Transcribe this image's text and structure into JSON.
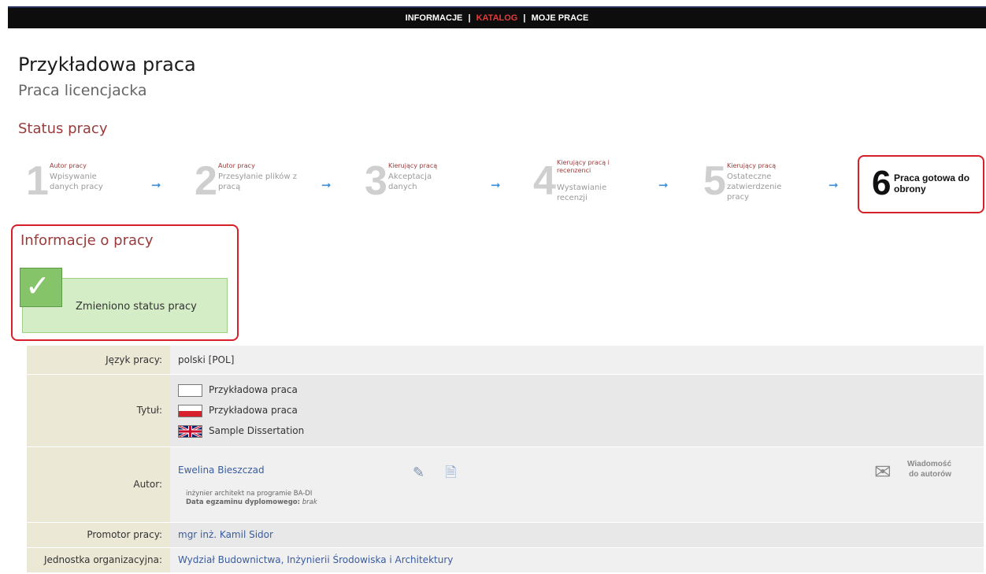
{
  "nav": {
    "items": [
      "INFORMACJE",
      "KATALOG",
      "MOJE PRACE"
    ],
    "separator": "|"
  },
  "page": {
    "title": "Przykładowa praca",
    "subtitle": "Praca licencjacka"
  },
  "status": {
    "section_title": "Status pracy",
    "steps": [
      {
        "num": "1",
        "who": "Autor pracy",
        "desc": "Wpisywanie danych pracy"
      },
      {
        "num": "2",
        "who": "Autor pracy",
        "desc": "Przesyłanie plików z pracą"
      },
      {
        "num": "3",
        "who": "Kierujący pracą",
        "desc": "Akceptacja danych"
      },
      {
        "num": "4",
        "who": "Kierujący pracą i recenzenci",
        "desc": "Wystawianie recenzji"
      },
      {
        "num": "5",
        "who": "Kierujący pracą",
        "desc": "Ostateczne zatwierdzenie pracy"
      }
    ],
    "final": {
      "num": "6",
      "label": "Praca gotowa do obrony"
    },
    "arrow_glyph": "➞"
  },
  "info": {
    "section_title": "Informacje o pracy",
    "notification": "Zmieniono status pracy"
  },
  "details": {
    "language_label": "Język pracy:",
    "language_value": "polski [POL]",
    "title_label": "Tytuł:",
    "titles": [
      "Przykładowa praca",
      "Przykładowa praca",
      "Sample Dissertation"
    ],
    "author_label": "Autor:",
    "author_name": "Ewelina Bieszczad",
    "author_program": "inżynier architekt na programie BA-DI",
    "exam_label": "Data egzaminu dyplomowego:",
    "exam_value": "brak",
    "message_label_1": "Wiadomość",
    "message_label_2": "do autorów",
    "supervisor_label": "Promotor pracy:",
    "supervisor_value": "mgr inż. Kamil Sidor",
    "unit_label": "Jednostka organizacyjna:",
    "unit_value": "Wydział Budownictwa, Inżynierii Środowiska i Architektury"
  },
  "colors": {
    "accent": "#9a3b3b",
    "highlight": "#d8202a",
    "nav_active": "#e23b3b",
    "link": "#3a5c9e"
  }
}
